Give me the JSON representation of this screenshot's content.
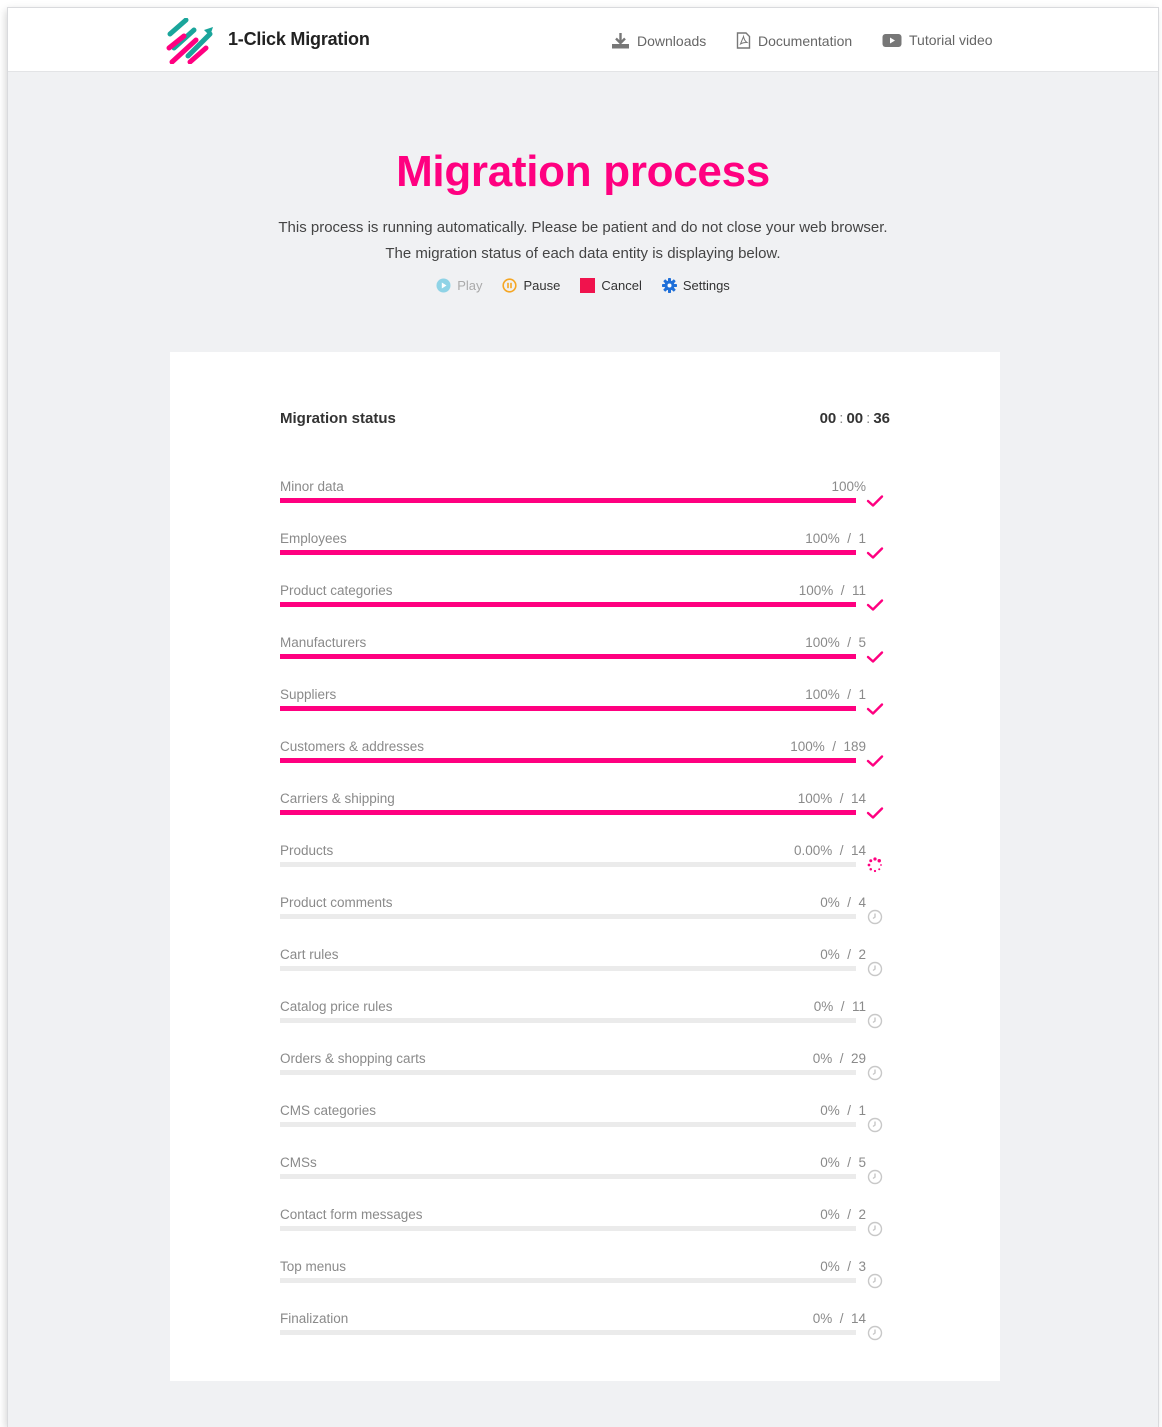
{
  "header": {
    "brand": "1-Click Migration",
    "nav": [
      {
        "label": "Downloads",
        "icon": "download-icon"
      },
      {
        "label": "Documentation",
        "icon": "pdf-file-icon"
      },
      {
        "label": "Tutorial video",
        "icon": "youtube-icon"
      }
    ]
  },
  "main": {
    "title": "Migration process",
    "description": [
      "This process is running automatically. Please be patient and do not close your web browser.",
      "The migration status of each data entity is displaying below."
    ],
    "controls": [
      {
        "label": "Play",
        "icon": "play-icon",
        "enabled": false
      },
      {
        "label": "Pause",
        "icon": "pause-icon",
        "enabled": true
      },
      {
        "label": "Cancel",
        "icon": "stop-icon",
        "enabled": true
      },
      {
        "label": "Settings",
        "icon": "gear-icon",
        "enabled": true
      }
    ]
  },
  "status": {
    "title": "Migration status",
    "timer": {
      "h": "00",
      "m": "00",
      "s": "36"
    },
    "entities": [
      {
        "label": "Minor data",
        "progress_text": "100%",
        "progress": 1.0,
        "state": "done"
      },
      {
        "label": "Employees",
        "progress_text": "100%  /  1",
        "progress": 1.0,
        "state": "done"
      },
      {
        "label": "Product categories",
        "progress_text": "100%  /  11",
        "progress": 1.0,
        "state": "done"
      },
      {
        "label": "Manufacturers",
        "progress_text": "100%  /  5",
        "progress": 1.0,
        "state": "done"
      },
      {
        "label": "Suppliers",
        "progress_text": "100%  /  1",
        "progress": 1.0,
        "state": "done"
      },
      {
        "label": "Customers & addresses",
        "progress_text": "100%  /  189",
        "progress": 1.0,
        "state": "done"
      },
      {
        "label": "Carriers & shipping",
        "progress_text": "100%  /  14",
        "progress": 1.0,
        "state": "done"
      },
      {
        "label": "Products",
        "progress_text": "0.00%  /  14",
        "progress": 0.0,
        "state": "running"
      },
      {
        "label": "Product comments",
        "progress_text": "0%  /  4",
        "progress": 0.0,
        "state": "pending"
      },
      {
        "label": "Cart rules",
        "progress_text": "0%  /  2",
        "progress": 0.0,
        "state": "pending"
      },
      {
        "label": "Catalog price rules",
        "progress_text": "0%  /  11",
        "progress": 0.0,
        "state": "pending"
      },
      {
        "label": "Orders & shopping carts",
        "progress_text": "0%  /  29",
        "progress": 0.0,
        "state": "pending"
      },
      {
        "label": "CMS categories",
        "progress_text": "0%  /  1",
        "progress": 0.0,
        "state": "pending"
      },
      {
        "label": "CMSs",
        "progress_text": "0%  /  5",
        "progress": 0.0,
        "state": "pending"
      },
      {
        "label": "Contact form messages",
        "progress_text": "0%  /  2",
        "progress": 0.0,
        "state": "pending"
      },
      {
        "label": "Top menus",
        "progress_text": "0%  /  3",
        "progress": 0.0,
        "state": "pending"
      },
      {
        "label": "Finalization",
        "progress_text": "0%  /  14",
        "progress": 0.0,
        "state": "pending"
      }
    ]
  },
  "colors": {
    "accent": "#ff0080",
    "done_check": "#ff0080",
    "pending_icon": "#c8c8c8",
    "play": "#8fd3e6",
    "pause": "#f5a623",
    "cancel": "#f0134d",
    "settings": "#1e6fd9",
    "logo_teal": "#1aa59b"
  }
}
